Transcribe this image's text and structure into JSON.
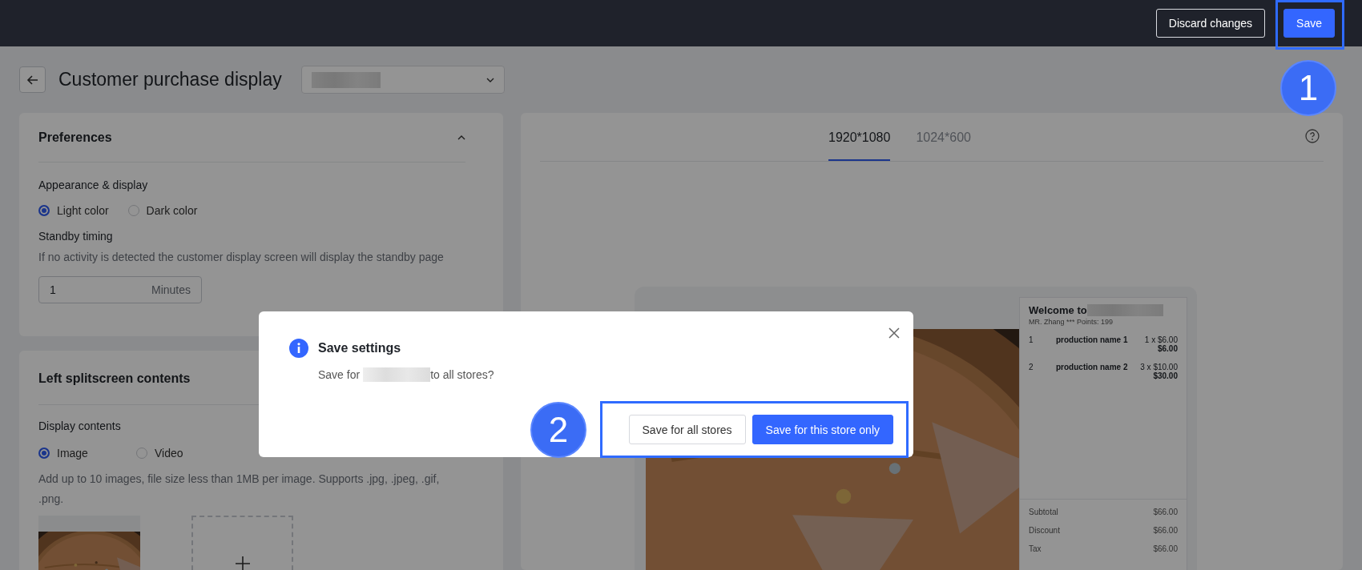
{
  "top_bar": {
    "buttons": [
      {
        "label": "Discard changes",
        "kind": "secondary"
      },
      {
        "label": "Save",
        "kind": "primary"
      }
    ]
  },
  "header": {
    "title": "Customer purchase display"
  },
  "preferences": {
    "title": "Preferences",
    "expanded": true,
    "appearance_label": "Appearance & display",
    "appearance_options": [
      {
        "label": "Light color",
        "selected": true
      },
      {
        "label": "Dark color",
        "selected": false
      }
    ],
    "standby_label": "Standby timing",
    "standby_description": "If no activity is detected the customer display screen will display the standby page",
    "standby_input": {
      "value": "1",
      "unit": "Minutes"
    }
  },
  "left_splitscreen": {
    "title": "Left splitscreen contents",
    "display_label": "Display contents",
    "options": [
      {
        "label": "Image",
        "selected": true
      },
      {
        "label": "Video",
        "selected": false
      }
    ],
    "hint": "Add up to 10 images, file size less than 1MB per image. Supports .jpg, .jpeg, .gif, .png."
  },
  "preview": {
    "tabs": [
      {
        "label": "1920*1080",
        "selected": true
      },
      {
        "label": "1024*600",
        "selected": false
      }
    ],
    "receipt": {
      "welcome": "Welcome to",
      "customer": "MR. Zhang *** Points: 199",
      "items": [
        {
          "index": "1",
          "name": "production name 1",
          "qty_price": "1 x $6.00",
          "total": "$6.00"
        },
        {
          "index": "2",
          "name": "production name 2",
          "qty_price": "3 x $10.00",
          "total": "$30.00"
        }
      ],
      "totals": [
        {
          "label": "Subtotal",
          "value": "$66.00"
        },
        {
          "label": "Discount",
          "value": "$66.00"
        },
        {
          "label": "Tax",
          "value": "$66.00"
        }
      ]
    }
  },
  "dialog": {
    "title": "Save settings",
    "message_before": "Save for",
    "message_after": "to all stores?",
    "buttons": [
      {
        "label": "Save for all stores",
        "kind": "secondary"
      },
      {
        "label": "Save for this store only",
        "kind": "primary"
      }
    ]
  },
  "annotations": [
    {
      "label": "1"
    },
    {
      "label": "2"
    }
  ]
}
